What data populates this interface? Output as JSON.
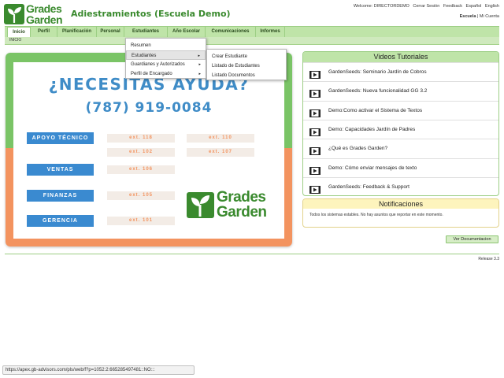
{
  "brand": {
    "line1": "Grades",
    "line2": "Garden"
  },
  "app_title": "Adiestramientos (Escuela Demo)",
  "top_links": [
    "Welcome: DIRECTORDEMO",
    "Cerrar Sesión",
    "Feedback",
    "Español",
    "English"
  ],
  "top_links2": {
    "active": "Escuela",
    "separator": "|",
    "other": "Mi Cuenta"
  },
  "nav": {
    "tabs": [
      "Inicio",
      "Perfil",
      "Planificación",
      "Personal",
      "Estudiantes",
      "Año Escolar",
      "Comunicaciones",
      "Informes"
    ],
    "active": "Inicio",
    "sub": "INICIO"
  },
  "menu_estudiantes": {
    "items": [
      "Resumen",
      "Estudiantes",
      "Guardianes y Autorizados",
      "Perfil de Encargado"
    ],
    "highlighted": "Estudiantes",
    "arrow": "▸"
  },
  "submenu_estudiantes": {
    "items": [
      "Crear Estudiante",
      "Listado de Estudiantes",
      "Listado Documentos"
    ]
  },
  "banner": {
    "headline": "¿NECESITAS AYUDA?",
    "phone": "(787) 919-0084",
    "departments": [
      "APOYO TÉCNICO",
      "VENTAS",
      "FINANZAS",
      "GERENCIA"
    ],
    "extensions": [
      "ext. 118",
      "ext. 110",
      "ext. 102",
      "ext. 107",
      "ext. 106",
      "ext. 105",
      "ext. 101"
    ],
    "logo_line1": "Grades",
    "logo_line2": "Garden",
    "colors": {
      "green": "#7ac466",
      "orange": "#f3935f",
      "blue": "#3a8ad0"
    }
  },
  "videos": {
    "title": "Videos Tutoriales",
    "items": [
      "GardenSeeds: Seminario Jardín de Cobros",
      "GardenSeeds: Nueva funcionalidad GG 3.2",
      "Demo:Como activar el Sistema de Textos",
      "Demo: Capacidades Jardín de Padres",
      "¿Qué es Grades Garden?",
      "Demo: Cómo enviar mensajes de texto",
      "GardenSeeds: Feedback & Support"
    ],
    "icon": "video-play-icon"
  },
  "notifications": {
    "title": "Notificaciones",
    "text": "Todos los sistemas estables. No hay asuntos que reportar en este momento."
  },
  "docs_button": "Ver Documentacion",
  "release": "Release 3.3",
  "status_url": "https://apex.gb-advisors.com/pls/web/f?p=1052:2:665285497481::NO:::"
}
